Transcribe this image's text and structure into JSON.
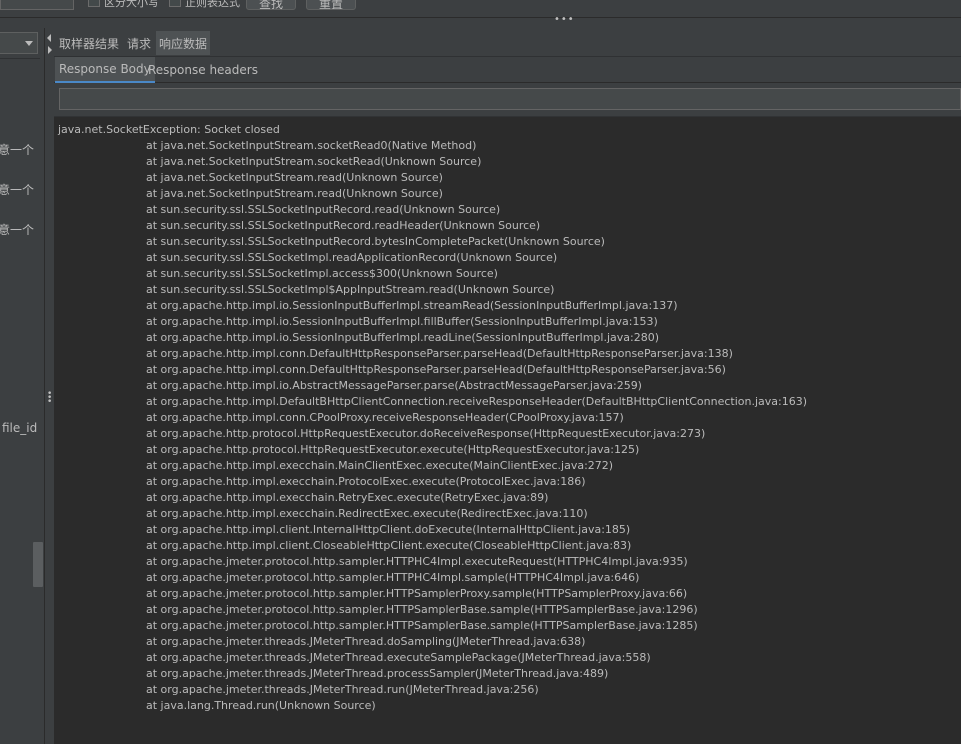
{
  "top_toolbar": {
    "check_case_label": "区分大小写",
    "check_regex_label": "正则表达式",
    "find_button": "查找",
    "reset_button": "重置"
  },
  "left_panel": {
    "items": [
      {
        "label": "意一个"
      },
      {
        "label": "意一个"
      },
      {
        "label": "意一个"
      },
      {
        "label": "file_id"
      }
    ]
  },
  "tabs": [
    {
      "label": "取样器结果",
      "active": false
    },
    {
      "label": "请求",
      "active": false
    },
    {
      "label": "响应数据",
      "active": true
    }
  ],
  "subtabs": [
    {
      "label": "Response Body",
      "active": true
    },
    {
      "label": "Response headers",
      "active": false
    }
  ],
  "search": {
    "value": ""
  },
  "response": {
    "exception": "java.net.SocketException: Socket closed",
    "frames": [
      "at java.net.SocketInputStream.socketRead0(Native Method)",
      "at java.net.SocketInputStream.socketRead(Unknown Source)",
      "at java.net.SocketInputStream.read(Unknown Source)",
      "at java.net.SocketInputStream.read(Unknown Source)",
      "at sun.security.ssl.SSLSocketInputRecord.read(Unknown Source)",
      "at sun.security.ssl.SSLSocketInputRecord.readHeader(Unknown Source)",
      "at sun.security.ssl.SSLSocketInputRecord.bytesInCompletePacket(Unknown Source)",
      "at sun.security.ssl.SSLSocketImpl.readApplicationRecord(Unknown Source)",
      "at sun.security.ssl.SSLSocketImpl.access$300(Unknown Source)",
      "at sun.security.ssl.SSLSocketImpl$AppInputStream.read(Unknown Source)",
      "at org.apache.http.impl.io.SessionInputBufferImpl.streamRead(SessionInputBufferImpl.java:137)",
      "at org.apache.http.impl.io.SessionInputBufferImpl.fillBuffer(SessionInputBufferImpl.java:153)",
      "at org.apache.http.impl.io.SessionInputBufferImpl.readLine(SessionInputBufferImpl.java:280)",
      "at org.apache.http.impl.conn.DefaultHttpResponseParser.parseHead(DefaultHttpResponseParser.java:138)",
      "at org.apache.http.impl.conn.DefaultHttpResponseParser.parseHead(DefaultHttpResponseParser.java:56)",
      "at org.apache.http.impl.io.AbstractMessageParser.parse(AbstractMessageParser.java:259)",
      "at org.apache.http.impl.DefaultBHttpClientConnection.receiveResponseHeader(DefaultBHttpClientConnection.java:163)",
      "at org.apache.http.impl.conn.CPoolProxy.receiveResponseHeader(CPoolProxy.java:157)",
      "at org.apache.http.protocol.HttpRequestExecutor.doReceiveResponse(HttpRequestExecutor.java:273)",
      "at org.apache.http.protocol.HttpRequestExecutor.execute(HttpRequestExecutor.java:125)",
      "at org.apache.http.impl.execchain.MainClientExec.execute(MainClientExec.java:272)",
      "at org.apache.http.impl.execchain.ProtocolExec.execute(ProtocolExec.java:186)",
      "at org.apache.http.impl.execchain.RetryExec.execute(RetryExec.java:89)",
      "at org.apache.http.impl.execchain.RedirectExec.execute(RedirectExec.java:110)",
      "at org.apache.http.impl.client.InternalHttpClient.doExecute(InternalHttpClient.java:185)",
      "at org.apache.http.impl.client.CloseableHttpClient.execute(CloseableHttpClient.java:83)",
      "at org.apache.jmeter.protocol.http.sampler.HTTPHC4Impl.executeRequest(HTTPHC4Impl.java:935)",
      "at org.apache.jmeter.protocol.http.sampler.HTTPHC4Impl.sample(HTTPHC4Impl.java:646)",
      "at org.apache.jmeter.protocol.http.sampler.HTTPSamplerProxy.sample(HTTPSamplerProxy.java:66)",
      "at org.apache.jmeter.protocol.http.sampler.HTTPSamplerBase.sample(HTTPSamplerBase.java:1296)",
      "at org.apache.jmeter.protocol.http.sampler.HTTPSamplerBase.sample(HTTPSamplerBase.java:1285)",
      "at org.apache.jmeter.threads.JMeterThread.doSampling(JMeterThread.java:638)",
      "at org.apache.jmeter.threads.JMeterThread.executeSamplePackage(JMeterThread.java:558)",
      "at org.apache.jmeter.threads.JMeterThread.processSampler(JMeterThread.java:489)",
      "at org.apache.jmeter.threads.JMeterThread.run(JMeterThread.java:256)",
      "at java.lang.Thread.run(Unknown Source)"
    ]
  }
}
